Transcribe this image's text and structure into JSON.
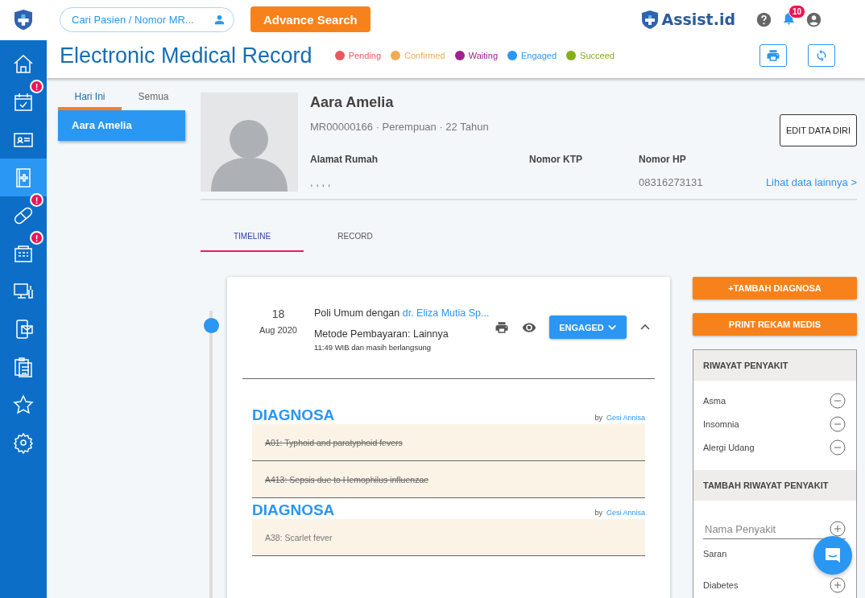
{
  "search": {
    "placeholder": "Cari Pasien / Nomor MR..."
  },
  "advance_search": "Advance Search",
  "brand": "Assist.id",
  "notifications": {
    "count": "10"
  },
  "page_title": "Electronic Medical Record",
  "legend": [
    {
      "label": "Pending",
      "color": "#e65a5f"
    },
    {
      "label": "Confirmed",
      "color": "#f2ab55"
    },
    {
      "label": "Waiting",
      "color": "#a0208f"
    },
    {
      "label": "Engaged",
      "color": "#2b96f3"
    },
    {
      "label": "Succeed",
      "color": "#87ad1b"
    }
  ],
  "sidebar": {
    "items": [
      {
        "selected": false
      },
      {
        "selected": false,
        "badge": "!"
      },
      {
        "selected": false
      },
      {
        "selected": true
      },
      {
        "selected": false,
        "badge": "!"
      },
      {
        "selected": false,
        "badge": "!"
      },
      {
        "selected": false
      },
      {
        "selected": false
      },
      {
        "selected": false
      },
      {
        "selected": false
      },
      {
        "selected": false
      }
    ]
  },
  "patient_tabs": [
    {
      "label": "Hari Ini",
      "selected": true
    },
    {
      "label": "Semua",
      "selected": false
    }
  ],
  "patient_list": [
    {
      "name": "Aara Amelia",
      "selected": true
    }
  ],
  "patient": {
    "name": "Aara Amelia",
    "info": "MR00000166 · Perempuan · 22 Tahun",
    "edit_button": "EDIT DATA DIRI",
    "fields": [
      {
        "label": "Alamat Rumah",
        "value": ", , , ,"
      },
      {
        "label": "Nomor KTP"
      },
      {
        "label": "Nomor HP",
        "value": "08316273131"
      }
    ],
    "more_link": "Lihat data lainnya >"
  },
  "record_tabs": [
    {
      "label": "TIMELINE",
      "selected": true
    },
    {
      "label": "RECORD",
      "selected": false
    }
  ],
  "visit": {
    "day": "18",
    "month_year": "Aug 2020",
    "clinic": "Poli Umum dengan",
    "doctor": "dr. Eliza Mutia Sp...",
    "payment": "Metode Pembayaran: Lainnya",
    "time": "11:49 WIB dan masih berlangsung",
    "status": "ENGAGED",
    "expanded": true,
    "diagnoses": [
      {
        "title": "DIAGNOSA",
        "by": "by",
        "author": "Gesi Annisa",
        "items": [
          {
            "text": "A01: Typhoid and paratyphoid fevers",
            "struck": true
          },
          {
            "text": "A413: Sepsis due to Hemophilus influenzae",
            "struck": true
          }
        ]
      },
      {
        "title": "DIAGNOSA",
        "by": "by",
        "author": "Gesi Annisa",
        "items": [
          {
            "text": "A38: Scarlet fever",
            "struck": false
          }
        ]
      }
    ]
  },
  "actions": [
    "+TAMBAH DIAGNOSA",
    "PRINT REKAM MEDIS"
  ],
  "history": {
    "title": "RIWAYAT PENYAKIT",
    "items": [
      "Asma",
      "Insomnia",
      "Alergi Udang"
    ],
    "add_title": "TAMBAH RIWAYAT PENYAKIT",
    "input": {
      "placeholder": "Nama Penyakit"
    },
    "suggestions_label": "Saran",
    "suggestions": [
      "Diabetes"
    ]
  }
}
